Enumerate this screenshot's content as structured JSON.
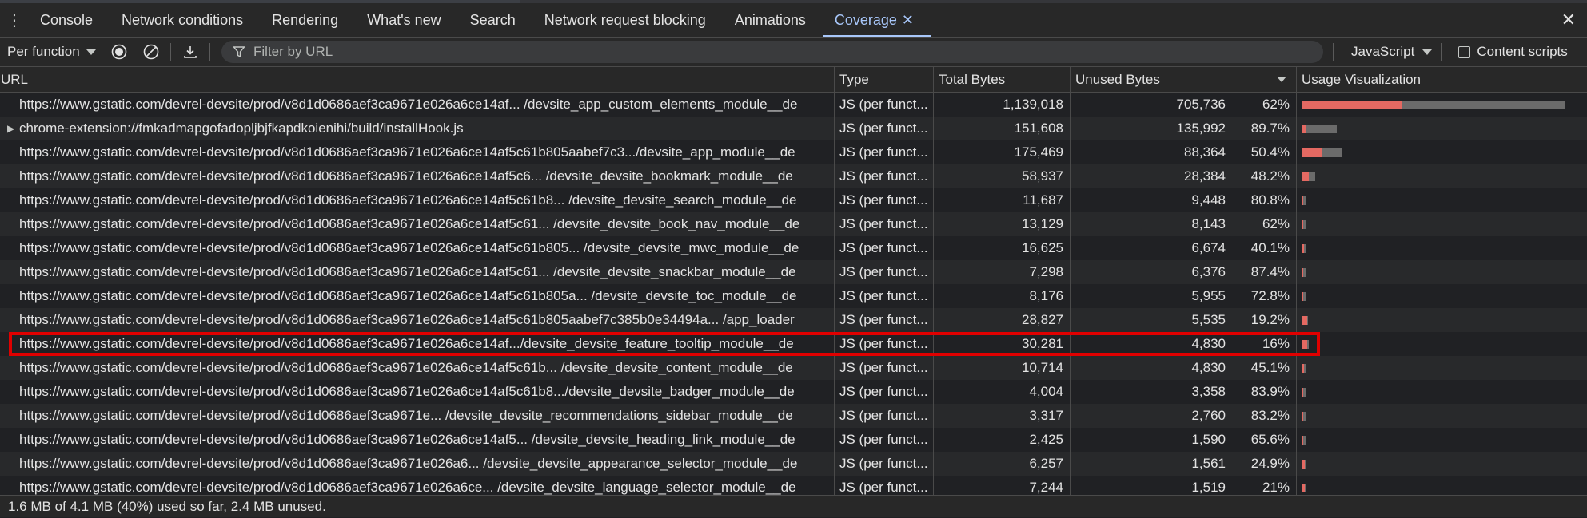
{
  "tabs": [
    {
      "label": "Console"
    },
    {
      "label": "Network conditions"
    },
    {
      "label": "Rendering"
    },
    {
      "label": "What's new"
    },
    {
      "label": "Search"
    },
    {
      "label": "Network request blocking"
    },
    {
      "label": "Animations"
    },
    {
      "label": "Coverage",
      "active": true
    }
  ],
  "toolbar": {
    "mode_select": "Per function",
    "filter_placeholder": "Filter by URL",
    "type_select": "JavaScript",
    "content_scripts_label": "Content scripts"
  },
  "columns": {
    "url": "URL",
    "type": "Type",
    "total": "Total Bytes",
    "unused": "Unused Bytes",
    "viz": "Usage Visualization"
  },
  "rows": [
    {
      "url": "https://www.gstatic.com/devrel-devsite/prod/v8d1d0686aef3ca9671e026a6ce14af... /devsite_app_custom_elements_module__de",
      "type": "JS (per funct...",
      "total": "1,139,018",
      "unused": "705,736",
      "pct": "62%",
      "used_frac": 0.38,
      "unused_frac": 0.62,
      "scale": 1.0
    },
    {
      "url": "chrome-extension://fmkadmapgofadopljbjfkapdkoienihi/build/installHook.js",
      "type": "JS (per funct...",
      "total": "151,608",
      "unused": "135,992",
      "pct": "89.7%",
      "used_frac": 0.103,
      "unused_frac": 0.897,
      "scale": 0.133,
      "expandable": true
    },
    {
      "url": "https://www.gstatic.com/devrel-devsite/prod/v8d1d0686aef3ca9671e026a6ce14af5c61b805aabef7c3.../devsite_app_module__de",
      "type": "JS (per funct...",
      "total": "175,469",
      "unused": "88,364",
      "pct": "50.4%",
      "used_frac": 0.496,
      "unused_frac": 0.504,
      "scale": 0.154
    },
    {
      "url": "https://www.gstatic.com/devrel-devsite/prod/v8d1d0686aef3ca9671e026a6ce14af5c6... /devsite_devsite_bookmark_module__de",
      "type": "JS (per funct...",
      "total": "58,937",
      "unused": "28,384",
      "pct": "48.2%",
      "used_frac": 0.518,
      "unused_frac": 0.482,
      "scale": 0.052
    },
    {
      "url": "https://www.gstatic.com/devrel-devsite/prod/v8d1d0686aef3ca9671e026a6ce14af5c61b8... /devsite_devsite_search_module__de",
      "type": "JS (per funct...",
      "total": "11,687",
      "unused": "9,448",
      "pct": "80.8%",
      "used_frac": 0.192,
      "unused_frac": 0.808,
      "scale": 0.0103
    },
    {
      "url": "https://www.gstatic.com/devrel-devsite/prod/v8d1d0686aef3ca9671e026a6ce14af5c61... /devsite_devsite_book_nav_module__de",
      "type": "JS (per funct...",
      "total": "13,129",
      "unused": "8,143",
      "pct": "62%",
      "used_frac": 0.38,
      "unused_frac": 0.62,
      "scale": 0.0115
    },
    {
      "url": "https://www.gstatic.com/devrel-devsite/prod/v8d1d0686aef3ca9671e026a6ce14af5c61b805... /devsite_devsite_mwc_module__de",
      "type": "JS (per funct...",
      "total": "16,625",
      "unused": "6,674",
      "pct": "40.1%",
      "used_frac": 0.599,
      "unused_frac": 0.401,
      "scale": 0.0146
    },
    {
      "url": "https://www.gstatic.com/devrel-devsite/prod/v8d1d0686aef3ca9671e026a6ce14af5c61... /devsite_devsite_snackbar_module__de",
      "type": "JS (per funct...",
      "total": "7,298",
      "unused": "6,376",
      "pct": "87.4%",
      "used_frac": 0.126,
      "unused_frac": 0.874,
      "scale": 0.0064
    },
    {
      "url": "https://www.gstatic.com/devrel-devsite/prod/v8d1d0686aef3ca9671e026a6ce14af5c61b805a... /devsite_devsite_toc_module__de",
      "type": "JS (per funct...",
      "total": "8,176",
      "unused": "5,955",
      "pct": "72.8%",
      "used_frac": 0.272,
      "unused_frac": 0.728,
      "scale": 0.0072
    },
    {
      "url": "https://www.gstatic.com/devrel-devsite/prod/v8d1d0686aef3ca9671e026a6ce14af5c61b805aabef7c385b0e34494a... /app_loader",
      "type": "JS (per funct...",
      "total": "28,827",
      "unused": "5,535",
      "pct": "19.2%",
      "used_frac": 0.808,
      "unused_frac": 0.192,
      "scale": 0.0253
    },
    {
      "url": "https://www.gstatic.com/devrel-devsite/prod/v8d1d0686aef3ca9671e026a6ce14af.../devsite_devsite_feature_tooltip_module__de",
      "type": "JS (per funct...",
      "total": "30,281",
      "unused": "4,830",
      "pct": "16%",
      "used_frac": 0.84,
      "unused_frac": 0.16,
      "scale": 0.0266,
      "selected": true
    },
    {
      "url": "https://www.gstatic.com/devrel-devsite/prod/v8d1d0686aef3ca9671e026a6ce14af5c61b... /devsite_devsite_content_module__de",
      "type": "JS (per funct...",
      "total": "10,714",
      "unused": "4,830",
      "pct": "45.1%",
      "used_frac": 0.549,
      "unused_frac": 0.451,
      "scale": 0.0094
    },
    {
      "url": "https://www.gstatic.com/devrel-devsite/prod/v8d1d0686aef3ca9671e026a6ce14af5c61b8.../devsite_devsite_badger_module__de",
      "type": "JS (per funct...",
      "total": "4,004",
      "unused": "3,358",
      "pct": "83.9%",
      "used_frac": 0.161,
      "unused_frac": 0.839,
      "scale": 0.0035
    },
    {
      "url": "https://www.gstatic.com/devrel-devsite/prod/v8d1d0686aef3ca9671e... /devsite_devsite_recommendations_sidebar_module__de",
      "type": "JS (per funct...",
      "total": "3,317",
      "unused": "2,760",
      "pct": "83.2%",
      "used_frac": 0.168,
      "unused_frac": 0.832,
      "scale": 0.0029
    },
    {
      "url": "https://www.gstatic.com/devrel-devsite/prod/v8d1d0686aef3ca9671e026a6ce14af5... /devsite_devsite_heading_link_module__de",
      "type": "JS (per funct...",
      "total": "2,425",
      "unused": "1,590",
      "pct": "65.6%",
      "used_frac": 0.344,
      "unused_frac": 0.656,
      "scale": 0.0021
    },
    {
      "url": "https://www.gstatic.com/devrel-devsite/prod/v8d1d0686aef3ca9671e026a6... /devsite_devsite_appearance_selector_module__de",
      "type": "JS (per funct...",
      "total": "6,257",
      "unused": "1,561",
      "pct": "24.9%",
      "used_frac": 0.751,
      "unused_frac": 0.249,
      "scale": 0.0055
    },
    {
      "url": "https://www.gstatic.com/devrel-devsite/prod/v8d1d0686aef3ca9671e026a6ce... /devsite_devsite_language_selector_module__de",
      "type": "JS (per funct...",
      "total": "7,244",
      "unused": "1,519",
      "pct": "21%",
      "used_frac": 0.79,
      "unused_frac": 0.21,
      "scale": 0.0064
    }
  ],
  "status": "1.6 MB of 4.1 MB (40%) used so far, 2.4 MB unused.",
  "colors": {
    "used": "#e46962",
    "unused": "#6b6b6b",
    "accent": "#a8c7fa",
    "highlight": "#e00000"
  }
}
